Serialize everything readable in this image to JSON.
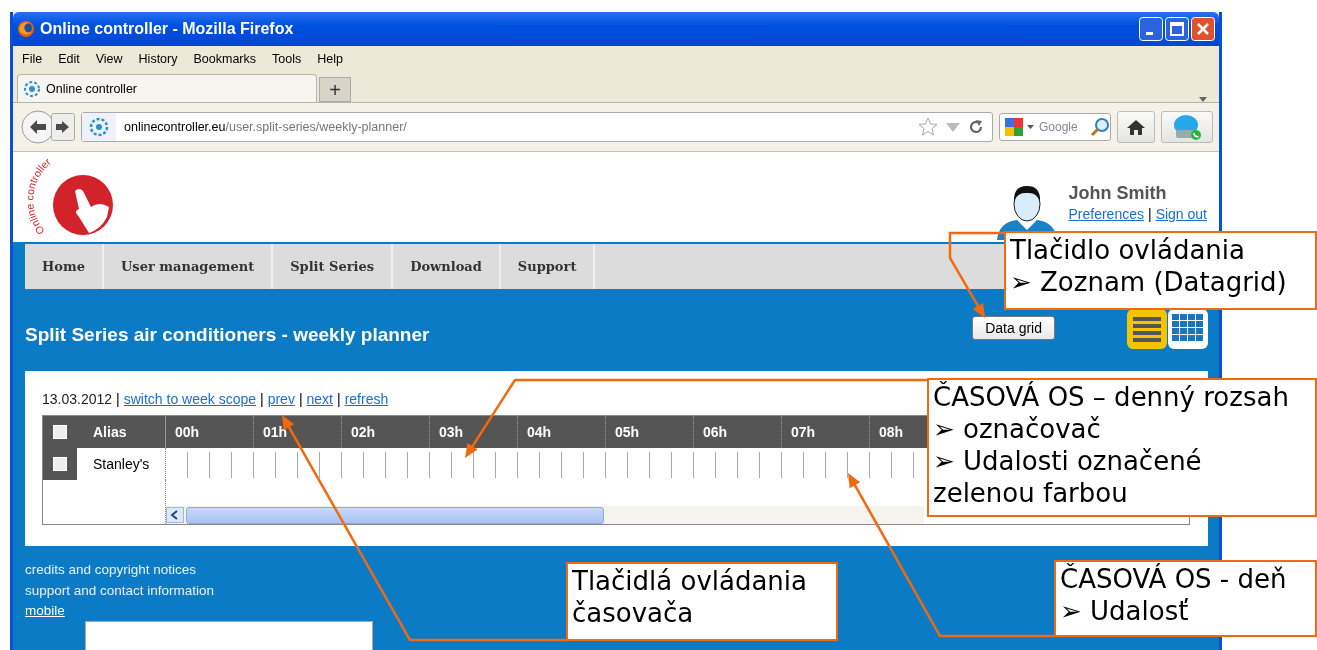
{
  "window": {
    "title": "Online controller - Mozilla Firefox"
  },
  "menu": [
    {
      "label": "File"
    },
    {
      "label": "Edit"
    },
    {
      "label": "View"
    },
    {
      "label": "History"
    },
    {
      "label": "Bookmarks"
    },
    {
      "label": "Tools"
    },
    {
      "label": "Help"
    }
  ],
  "tabs": [
    {
      "label": "Online controller",
      "selected": true
    }
  ],
  "new_tab": "+",
  "address": {
    "domain": "onlinecontroller.eu",
    "path": "/user.split-series/weekly-planner/"
  },
  "search": {
    "placeholder": "Google"
  },
  "page": {
    "logo_text": "Online controller",
    "user": {
      "name": "John Smith",
      "links": [
        "Preferences",
        "Sign out"
      ],
      "separator": "|"
    },
    "nav": [
      {
        "label": "Home"
      },
      {
        "label": "User management"
      },
      {
        "label": "Split Series"
      },
      {
        "label": "Download"
      },
      {
        "label": "Support"
      }
    ],
    "heading": "Split Series air conditioners - weekly planner",
    "data_grid_button": "Data grid",
    "views": [
      {
        "kind": "list",
        "selected": true
      },
      {
        "kind": "grid",
        "selected": false
      }
    ],
    "planner": {
      "date": "13.03.2012",
      "separator": "|",
      "actions": [
        "switch to week scope",
        "prev",
        "next",
        "refresh"
      ],
      "header": {
        "checked": false,
        "alias": "Alias",
        "hours": [
          "00h",
          "01h",
          "02h",
          "03h",
          "04h",
          "05h",
          "06h",
          "07h",
          "08h"
        ]
      },
      "rows": [
        {
          "alias": "Stanley's",
          "checked": false
        }
      ]
    },
    "footer": {
      "lines": [
        "credits and copyright notices",
        "support and contact information"
      ],
      "link": "mobile"
    }
  },
  "annotations": [
    {
      "title": "Tlačidlo ovládania",
      "items": [
        "➢  Zoznam (Datagrid)"
      ]
    },
    {
      "title": "ČASOVÁ OS – denný rozsah",
      "items": [
        "➢  označovač",
        "➢  Udalosti označené zelenou farbou"
      ]
    },
    {
      "title": "Tlačidlá ovládania časovača"
    },
    {
      "title": "ČASOVÁ OS - deň",
      "items": [
        "➢  Udalosť"
      ]
    }
  ]
}
